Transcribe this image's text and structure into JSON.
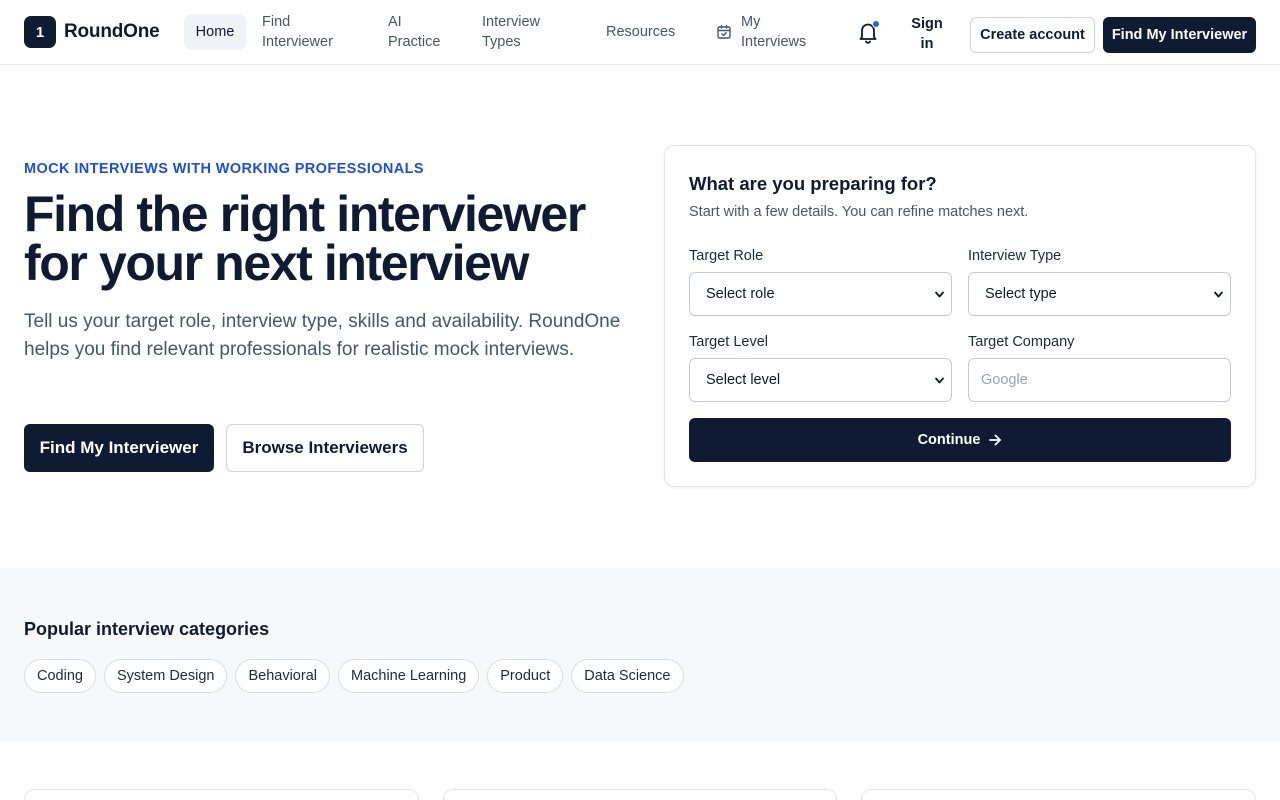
{
  "brand": {
    "logo_mark": "1",
    "name": "RoundOne"
  },
  "nav": {
    "home": "Home",
    "find_interviewer": "Find Interviewer",
    "ai_practice": "AI Practice",
    "interview_types": "Interview Types",
    "resources": "Resources",
    "my_interviews": "My Interviews",
    "sign_in": "Sign in",
    "create_account": "Create account",
    "find_my_interviewer": "Find My Interviewer"
  },
  "hero": {
    "eyebrow": "MOCK INTERVIEWS WITH WORKING PROFESSIONALS",
    "title": "Find the right interviewer for your next interview",
    "subtitle": "Tell us your target role, interview type, skills and availability. RoundOne helps you find relevant professionals for realistic mock interviews.",
    "primary_cta": "Find My Interviewer",
    "secondary_cta": "Browse Interviewers"
  },
  "form": {
    "title": "What are you preparing for?",
    "subtitle": "Start with a few details. You can refine matches next.",
    "role_label": "Target Role",
    "role_value": "Select role",
    "type_label": "Interview Type",
    "type_value": "Select type",
    "level_label": "Target Level",
    "level_value": "Select level",
    "company_label": "Target Company",
    "company_placeholder": "Google",
    "continue": "Continue"
  },
  "categories": {
    "title": "Popular interview categories",
    "items": [
      "Coding",
      "System Design",
      "Behavioral",
      "Machine Learning",
      "Product",
      "Data Science"
    ]
  },
  "colors": {
    "primary": "#0f1b33",
    "accent": "#1d4fd8",
    "notification_dot": "#2563eb"
  },
  "icons": {
    "calendar": "calendar-check-icon",
    "notifications": "bell-icon",
    "arrow": "arrow-right-icon",
    "select": "chevron-down-icon"
  }
}
